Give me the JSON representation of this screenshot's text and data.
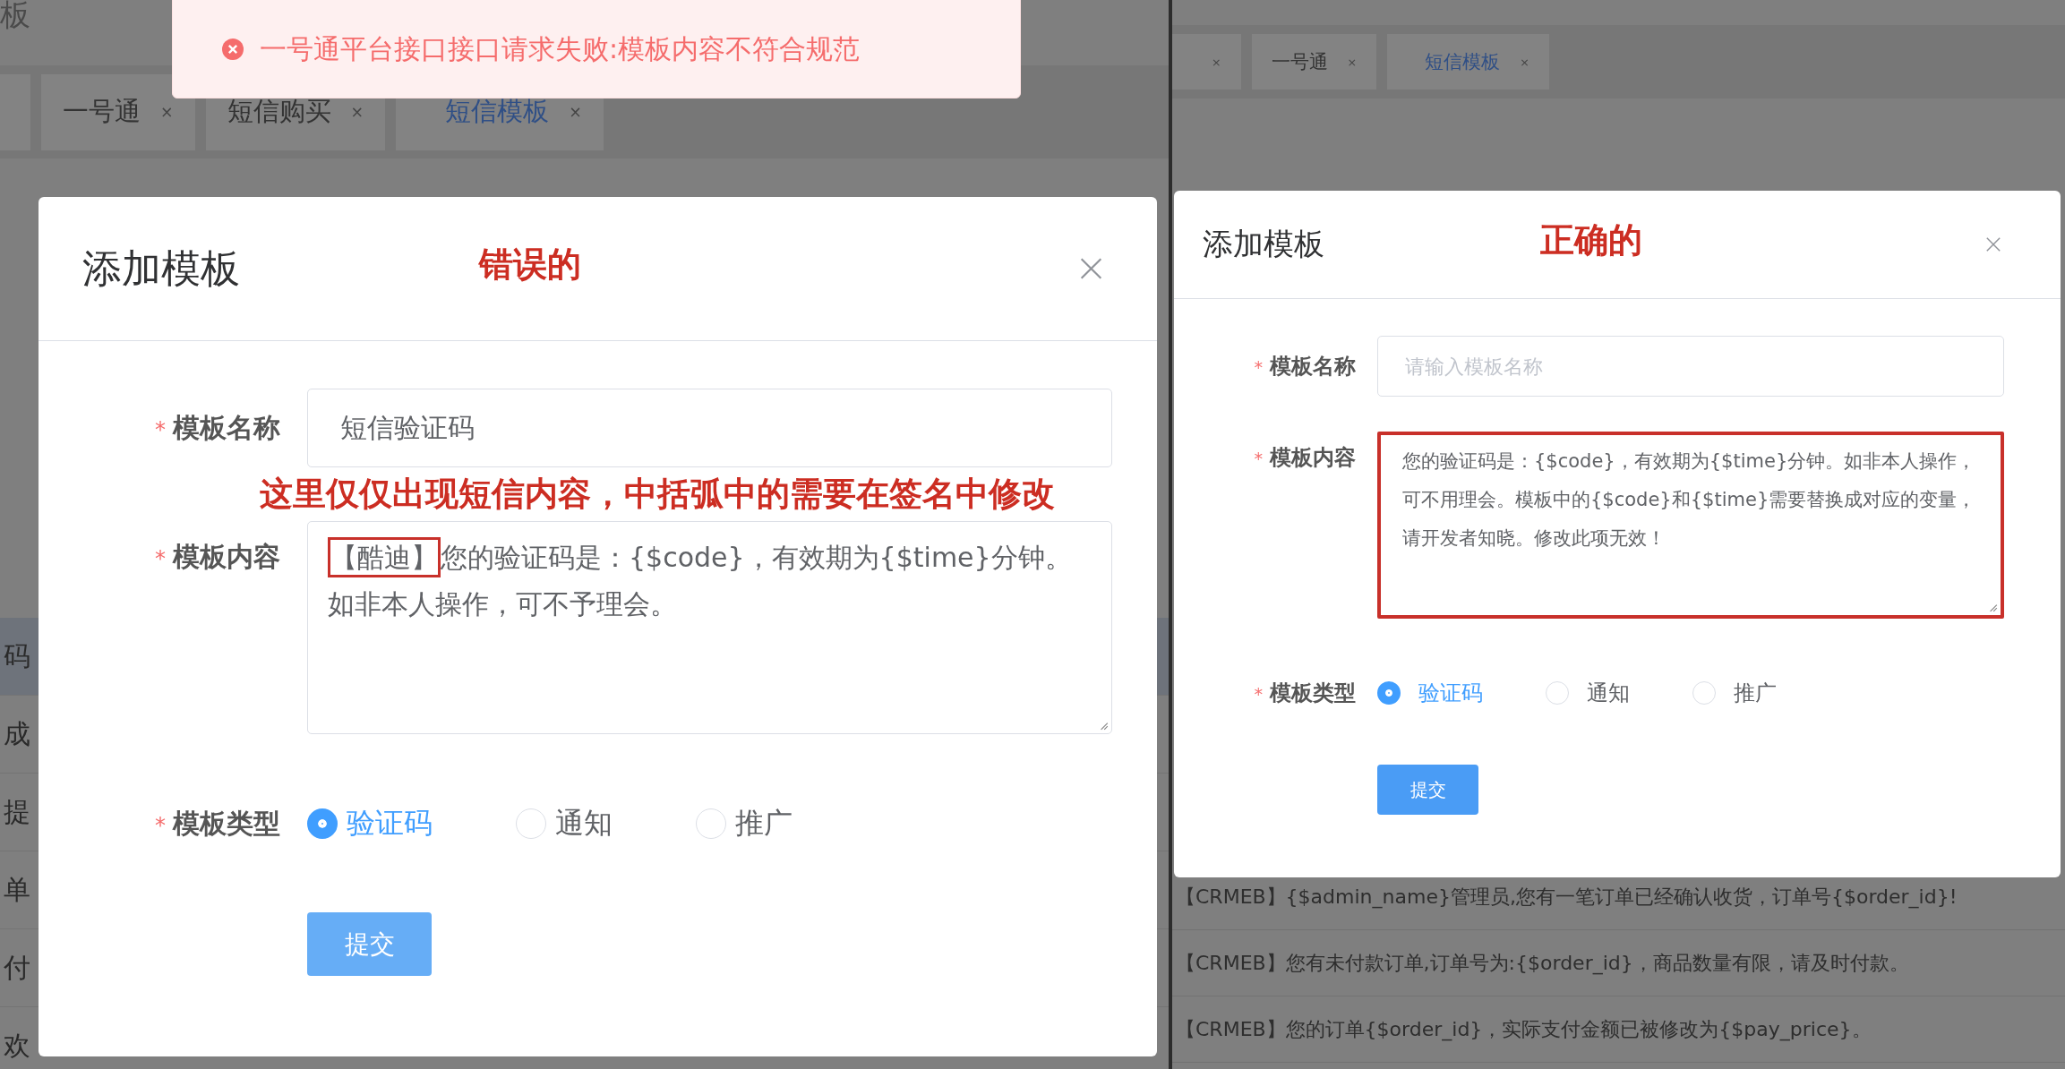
{
  "panels": [
    {
      "breadcrumb": "板",
      "toast": {
        "message": "一号通平台接口接口请求失败:模板内容不符合规范"
      },
      "tabs": [
        {
          "label": "一号通",
          "close": "×",
          "selected": false
        },
        {
          "label": "短信购买",
          "close": "×",
          "selected": false
        },
        {
          "label": "短信模板",
          "close": "×",
          "selected": true
        }
      ],
      "table_fragments": [
        "码",
        "成",
        "提",
        "单",
        "付",
        "欢"
      ],
      "dialog": {
        "title": "添加模板",
        "annotation": "错误的",
        "fields": [
          {
            "kind": "input",
            "marker": "*",
            "label": "模板名称",
            "value": "短信验证码",
            "note": "这里仅仅出现短信内容，中括弧中的需要在签名中修改"
          },
          {
            "kind": "textarea",
            "marker": "*",
            "label": "模板内容",
            "boxed": false,
            "parts": [
              {
                "text": "【酷迪】",
                "boxed": true
              },
              {
                "text": "您的验证码是：{$code}，有效期为{$time}分钟。如非本人操作，可不予理会。",
                "boxed": false
              }
            ]
          },
          {
            "kind": "radio",
            "marker": "*",
            "label": "模板类型",
            "options": [
              {
                "label": "验证码",
                "selected": true
              },
              {
                "label": "通知",
                "selected": false
              },
              {
                "label": "推广",
                "selected": false
              }
            ]
          }
        ],
        "submit": "提交"
      }
    },
    {
      "tabs": [
        {
          "close": "×",
          "selected": false
        },
        {
          "label": "一号通",
          "close": "×",
          "selected": false
        },
        {
          "label": "短信模板",
          "close": "×",
          "selected": true
        }
      ],
      "dialog": {
        "title": "添加模板",
        "annotation": "正确的",
        "fields": [
          {
            "kind": "input",
            "marker": "*",
            "label": "模板名称",
            "placeholder": "请输入模板名称"
          },
          {
            "kind": "textarea",
            "marker": "*",
            "label": "模板内容",
            "boxed": true,
            "parts": [
              {
                "text": "您的验证码是：{$code}，有效期为{$time}分钟。如非本人操作，可不用理会。模板中的{$code}和{$time}需要替换成对应的变量，请开发者知晓。修改此项无效！",
                "boxed": false
              }
            ]
          },
          {
            "kind": "radio",
            "marker": "*",
            "label": "模板类型",
            "options": [
              {
                "label": "验证码",
                "selected": true
              },
              {
                "label": "通知",
                "selected": false
              },
              {
                "label": "推广",
                "selected": false
              }
            ]
          }
        ],
        "submit": "提交"
      },
      "table_rows": [
        "【CRMEB】{$admin_name}管理员,您有一笔订单已经确认收货，订单号{$order_id}!",
        "【CRMEB】您有未付款订单,订单号为:{$order_id}，商品数量有限，请及时付款。",
        "【CRMEB】您的订单{$order_id}，实际支付金额已被修改为{$pay_price}。"
      ]
    }
  ]
}
